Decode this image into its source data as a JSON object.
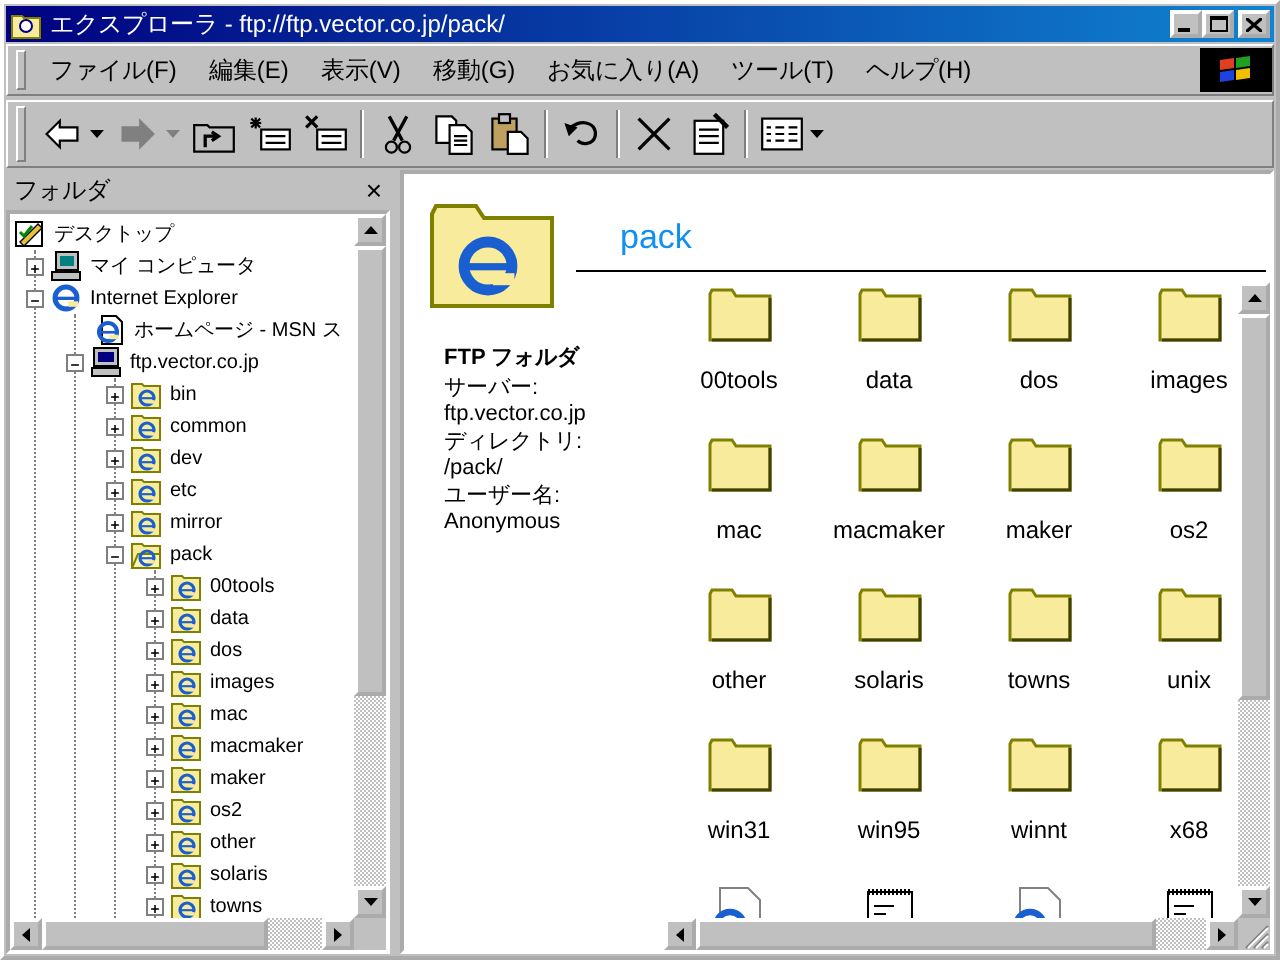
{
  "window": {
    "title": "エクスプローラ - ftp://ftp.vector.co.jp/pack/"
  },
  "menu": [
    "ファイル(F)",
    "編集(E)",
    "表示(V)",
    "移動(G)",
    "お気に入り(A)",
    "ツール(T)",
    "ヘルプ(H)"
  ],
  "toolbar": [
    {
      "kind": "back",
      "disabled": false,
      "dropdown": true
    },
    {
      "kind": "forward",
      "disabled": true,
      "dropdown": true
    },
    {
      "kind": "up",
      "disabled": false,
      "dropdown": false
    },
    {
      "kind": "map-drive",
      "disabled": false,
      "dropdown": false
    },
    {
      "kind": "disconnect",
      "disabled": false,
      "dropdown": false
    },
    {
      "kind": "separator"
    },
    {
      "kind": "cut",
      "disabled": false,
      "dropdown": false
    },
    {
      "kind": "copy",
      "disabled": false,
      "dropdown": false
    },
    {
      "kind": "paste",
      "disabled": false,
      "dropdown": false
    },
    {
      "kind": "separator"
    },
    {
      "kind": "undo",
      "disabled": false,
      "dropdown": false
    },
    {
      "kind": "separator"
    },
    {
      "kind": "delete",
      "disabled": false,
      "dropdown": false
    },
    {
      "kind": "properties",
      "disabled": false,
      "dropdown": false
    },
    {
      "kind": "separator"
    },
    {
      "kind": "views",
      "disabled": false,
      "dropdown": true
    }
  ],
  "folders_pane": {
    "title": "フォルダ",
    "close": "×",
    "tree": [
      {
        "label": "デスクトップ",
        "kind": "desktop",
        "children": [
          {
            "label": "マイ コンピュータ",
            "kind": "computer",
            "expanded": false
          },
          {
            "label": "Internet Explorer",
            "kind": "ie",
            "expanded": true,
            "children": [
              {
                "label": "ホームページ - MSN ス",
                "kind": "web-page"
              },
              {
                "label": "ftp.vector.co.jp",
                "kind": "ftp-server",
                "expanded": true,
                "children": [
                  {
                    "label": "bin",
                    "kind": "ie-folder",
                    "expanded": false
                  },
                  {
                    "label": "common",
                    "kind": "ie-folder",
                    "expanded": false
                  },
                  {
                    "label": "dev",
                    "kind": "ie-folder",
                    "expanded": false
                  },
                  {
                    "label": "etc",
                    "kind": "ie-folder",
                    "expanded": false
                  },
                  {
                    "label": "mirror",
                    "kind": "ie-folder",
                    "expanded": false
                  },
                  {
                    "label": "pack",
                    "kind": "ie-folder-open",
                    "expanded": true,
                    "children": [
                      {
                        "label": "00tools",
                        "kind": "ie-folder",
                        "expanded": false
                      },
                      {
                        "label": "data",
                        "kind": "ie-folder",
                        "expanded": false
                      },
                      {
                        "label": "dos",
                        "kind": "ie-folder",
                        "expanded": false
                      },
                      {
                        "label": "images",
                        "kind": "ie-folder",
                        "expanded": false
                      },
                      {
                        "label": "mac",
                        "kind": "ie-folder",
                        "expanded": false
                      },
                      {
                        "label": "macmaker",
                        "kind": "ie-folder",
                        "expanded": false
                      },
                      {
                        "label": "maker",
                        "kind": "ie-folder",
                        "expanded": false
                      },
                      {
                        "label": "os2",
                        "kind": "ie-folder",
                        "expanded": false
                      },
                      {
                        "label": "other",
                        "kind": "ie-folder",
                        "expanded": false
                      },
                      {
                        "label": "solaris",
                        "kind": "ie-folder",
                        "expanded": false
                      },
                      {
                        "label": "towns",
                        "kind": "ie-folder",
                        "expanded": false
                      }
                    ]
                  }
                ]
              }
            ]
          }
        ]
      }
    ]
  },
  "content": {
    "title": "pack",
    "info": {
      "heading": "FTP フォルダ",
      "lines": [
        "サーバー: ftp.vector.co.jp",
        "ディレクトリ: /pack/",
        "ユーザー名: Anonymous"
      ]
    },
    "items": [
      {
        "kind": "folder",
        "name": "00tools"
      },
      {
        "kind": "folder",
        "name": "data"
      },
      {
        "kind": "folder",
        "name": "dos"
      },
      {
        "kind": "folder",
        "name": "images"
      },
      {
        "kind": "folder",
        "name": "mac"
      },
      {
        "kind": "folder",
        "name": "macmaker"
      },
      {
        "kind": "folder",
        "name": "maker"
      },
      {
        "kind": "folder",
        "name": "os2"
      },
      {
        "kind": "folder",
        "name": "other"
      },
      {
        "kind": "folder",
        "name": "solaris"
      },
      {
        "kind": "folder",
        "name": "towns"
      },
      {
        "kind": "folder",
        "name": "unix"
      },
      {
        "kind": "folder",
        "name": "win31"
      },
      {
        "kind": "folder",
        "name": "win95"
      },
      {
        "kind": "folder",
        "name": "winnt"
      },
      {
        "kind": "folder",
        "name": "x68"
      },
      {
        "kind": "web-page"
      },
      {
        "kind": "text-file"
      },
      {
        "kind": "web-page"
      },
      {
        "kind": "text-file"
      }
    ]
  }
}
